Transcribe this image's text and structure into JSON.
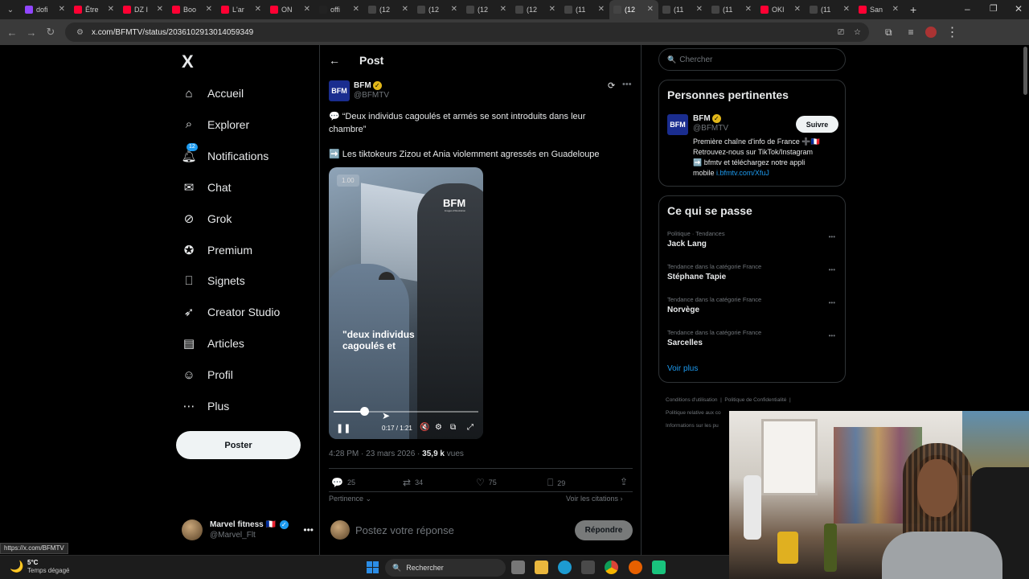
{
  "browser": {
    "tabs": [
      {
        "icon": "twitch-icon",
        "color": "#9146ff",
        "label": "dofi"
      },
      {
        "icon": "youtube-icon",
        "color": "#ff0033",
        "label": "Être"
      },
      {
        "icon": "youtube-icon",
        "color": "#ff0033",
        "label": "DZ I"
      },
      {
        "icon": "youtube-icon",
        "color": "#ff0033",
        "label": "Boo"
      },
      {
        "icon": "youtube-icon",
        "color": "#ff0033",
        "label": "L'ar"
      },
      {
        "icon": "youtube-icon",
        "color": "#ff0033",
        "label": "ON"
      },
      {
        "icon": "tiktok-icon",
        "color": "#222222",
        "label": "offi"
      },
      {
        "icon": "x-icon",
        "color": "#444444",
        "label": "(12"
      },
      {
        "icon": "x-icon",
        "color": "#444444",
        "label": "(12"
      },
      {
        "icon": "x-icon",
        "color": "#444444",
        "label": "(12"
      },
      {
        "icon": "x-icon",
        "color": "#444444",
        "label": "(12"
      },
      {
        "icon": "x-icon",
        "color": "#444444",
        "label": "(11"
      },
      {
        "icon": "x-icon",
        "color": "#444444",
        "label": "(12",
        "active": true
      },
      {
        "icon": "x-icon",
        "color": "#444444",
        "label": "(11"
      },
      {
        "icon": "x-icon",
        "color": "#444444",
        "label": "(11"
      },
      {
        "icon": "youtube-icon",
        "color": "#ff0033",
        "label": "OKI"
      },
      {
        "icon": "x-icon",
        "color": "#444444",
        "label": "(11"
      },
      {
        "icon": "youtube-icon",
        "color": "#ff0033",
        "label": "San"
      }
    ],
    "url": "x.com/BFMTV/status/2036102913014059349",
    "status_url": "https://x.com/BFMTV"
  },
  "nav": {
    "logo": "X",
    "items": [
      {
        "label": "Accueil",
        "icon": "home-icon"
      },
      {
        "label": "Explorer",
        "icon": "search-icon"
      },
      {
        "label": "Notifications",
        "icon": "bell-icon",
        "badge": "12"
      },
      {
        "label": "Chat",
        "icon": "mail-icon"
      },
      {
        "label": "Grok",
        "icon": "grok-icon"
      },
      {
        "label": "Premium",
        "icon": "premium-icon"
      },
      {
        "label": "Signets",
        "icon": "bookmark-icon"
      },
      {
        "label": "Creator Studio",
        "icon": "rocket-icon"
      },
      {
        "label": "Articles",
        "icon": "article-icon"
      },
      {
        "label": "Profil",
        "icon": "profile-icon"
      },
      {
        "label": "Plus",
        "icon": "more-circle-icon"
      }
    ],
    "post_button": "Poster",
    "account": {
      "name": "Marvel fitness 🇫🇷",
      "handle": "@Marvel_Flt"
    }
  },
  "post": {
    "header_title": "Post",
    "author": {
      "name": "BFM",
      "handle": "@BFMTV",
      "logo": "BFM"
    },
    "text_line1": "💬 “Deux individus cagoulés et armés se sont introduits dans leur chambre”",
    "text_line2": "➡️ Les tiktokeurs Zizou et Ania violemment agressés en Guadeloupe",
    "video": {
      "speed": "1.00",
      "watermark": "BFM",
      "watermark_sub": "Images d'illustration",
      "caption_line1": "\"deux individus",
      "caption_line2": "cagoulés et",
      "time": "0:17 / 1:21",
      "progress": 0.21
    },
    "meta": {
      "time": "4:28 PM · 23 mars 2026 · ",
      "views": "35,9 k",
      "views_label": " vues"
    },
    "stats": {
      "replies": "25",
      "reposts": "34",
      "likes": "75",
      "bookmarks": "29"
    },
    "sort_label": "Pertinence",
    "quotes_label": "Voir les citations",
    "reply_placeholder": "Postez votre réponse",
    "reply_button": "Répondre"
  },
  "sidebar": {
    "search_placeholder": "Chercher",
    "people_title": "Personnes pertinentes",
    "person": {
      "name": "BFM",
      "handle": "@BFMTV",
      "follow": "Suivre",
      "bio_line1": "Première chaîne d'info de France ➕🇫🇷",
      "bio_line2": "Retrouvez-nous sur TikTok/Instagram",
      "bio_line3": "➡️ bfmtv et téléchargez notre appli",
      "bio_line4": "mobile ",
      "bio_link": "i.bfmtv.com/XfuJ"
    },
    "trends_title": "Ce qui se passe",
    "trends": [
      {
        "context": "Politique · Tendances",
        "name": "Jack Lang"
      },
      {
        "context": "Tendance dans la catégorie France",
        "name": "Stéphane Tapie"
      },
      {
        "context": "Tendance dans la catégorie France",
        "name": "Norvège"
      },
      {
        "context": "Tendance dans la catégorie France",
        "name": "Sarcelles"
      }
    ],
    "show_more": "Voir plus",
    "footer_line1a": "Conditions d'utilisation",
    "footer_line1b": "Politique de Confidentialité",
    "footer_line2": "Politique relative aux co",
    "footer_line3": "Informations sur les pu"
  },
  "taskbar": {
    "weather_temp": "5°C",
    "weather_desc": "Temps dégagé",
    "search": "Rechercher"
  },
  "colors": {
    "accent": "#1d9bf0",
    "muted": "#71767b",
    "border": "#2f3336"
  }
}
